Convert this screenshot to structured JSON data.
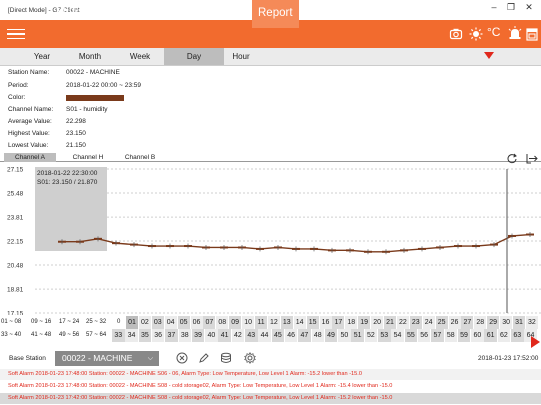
{
  "window": {
    "title": "[Direct Mode] - G7 Client",
    "controls": [
      "–",
      "❐",
      "✕"
    ]
  },
  "nav": {
    "items": [
      "Meter",
      "HMI",
      "Data",
      "Compare",
      "Report"
    ],
    "active": "Report",
    "toolbar_icons": [
      "camera-icon",
      "brightness-icon",
      "celsius-icon",
      "alarm-icon",
      "calendar-icon"
    ],
    "celsius_label": "°C"
  },
  "period_tabs": {
    "items": [
      "Year",
      "Month",
      "Week",
      "Day",
      "Hour"
    ],
    "active": "Day"
  },
  "info": {
    "labels": {
      "station": "Station Name:",
      "period": "Period:",
      "color": "Color:",
      "channel": "Channel Name:",
      "avg": "Average Value:",
      "high": "Highest Value:",
      "low": "Lowest Value:"
    },
    "values": {
      "station": "00022 - MACHINE",
      "period": "2018-01-22  00:00 ~ 23:59",
      "color": "#7a3a1b",
      "channel": "S01 - humidity",
      "avg": "22.298",
      "high": "23.150",
      "low": "21.150"
    }
  },
  "channel_tabs": {
    "items": [
      "Channel A",
      "Channel H",
      "Channel B"
    ],
    "active": "Channel A"
  },
  "chart_data": {
    "type": "line",
    "y_ticks": [
      "27.15",
      "25.48",
      "23.81",
      "22.15",
      "20.48",
      "18.81",
      "17.15"
    ],
    "ylim": [
      17.15,
      27.15
    ],
    "grid": true,
    "tooltip": {
      "time": "2018-01-22 22:30:00",
      "value": "S01: 23.150 / 21.870"
    },
    "series": [
      {
        "color": "#7a3a1b",
        "values": [
          22.1,
          22.1,
          22.3,
          22.0,
          21.9,
          21.8,
          21.8,
          21.8,
          21.7,
          21.7,
          21.7,
          21.6,
          21.7,
          21.6,
          21.6,
          21.5,
          21.5,
          21.4,
          21.4,
          21.5,
          21.6,
          21.7,
          21.8,
          21.8,
          21.9,
          22.5,
          22.6
        ]
      }
    ]
  },
  "days": {
    "ranges_left": [
      "01 ~ 08",
      "09 ~ 16",
      "17 ~ 24",
      "25 ~ 32"
    ],
    "items": [
      "01",
      "02",
      "03",
      "04",
      "05",
      "06",
      "07",
      "08",
      "09",
      "10",
      "11",
      "12",
      "13",
      "14",
      "15",
      "16",
      "17",
      "18",
      "19",
      "20",
      "21",
      "22",
      "23",
      "24",
      "25",
      "26",
      "27",
      "28",
      "29",
      "30",
      "31",
      "32"
    ],
    "prefix": "0"
  },
  "weeks": {
    "ranges_left": [
      "33 ~ 40",
      "41 ~ 48",
      "49 ~ 56",
      "57 ~ 64"
    ],
    "items": [
      "33",
      "34",
      "35",
      "36",
      "37",
      "38",
      "39",
      "40",
      "41",
      "42",
      "43",
      "44",
      "45",
      "46",
      "47",
      "48",
      "49",
      "50",
      "51",
      "52",
      "53",
      "54",
      "55",
      "56",
      "57",
      "58",
      "59",
      "60",
      "61",
      "62",
      "63",
      "64"
    ]
  },
  "base_station": {
    "label": "Base Station",
    "selected": "00022 - MACHINE",
    "timestamp": "2018-01-23 17:52:00"
  },
  "alarms": [
    "Soft Alarm   2018-01-23 17:48:00   Station: 00022 - MACHINE   S06 - 06, Alarm Type: Low Temperature, Low Level 1 Alarm: -15.2 lower than -15.0",
    "Soft Alarm   2018-01-23 17:48:00   Station: 00022 - MACHINE   S08 - cold storage02, Alarm Type: Low Temperature, Low Level 1 Alarm: -15.4 lower than -15.0",
    "Soft Alarm   2018-01-23 17:42:00   Station: 00022 - MACHINE   S08 - cold storage02, Alarm Type: Low Temperature, Low Level 1 Alarm: -15.2 lower than -15.0"
  ]
}
